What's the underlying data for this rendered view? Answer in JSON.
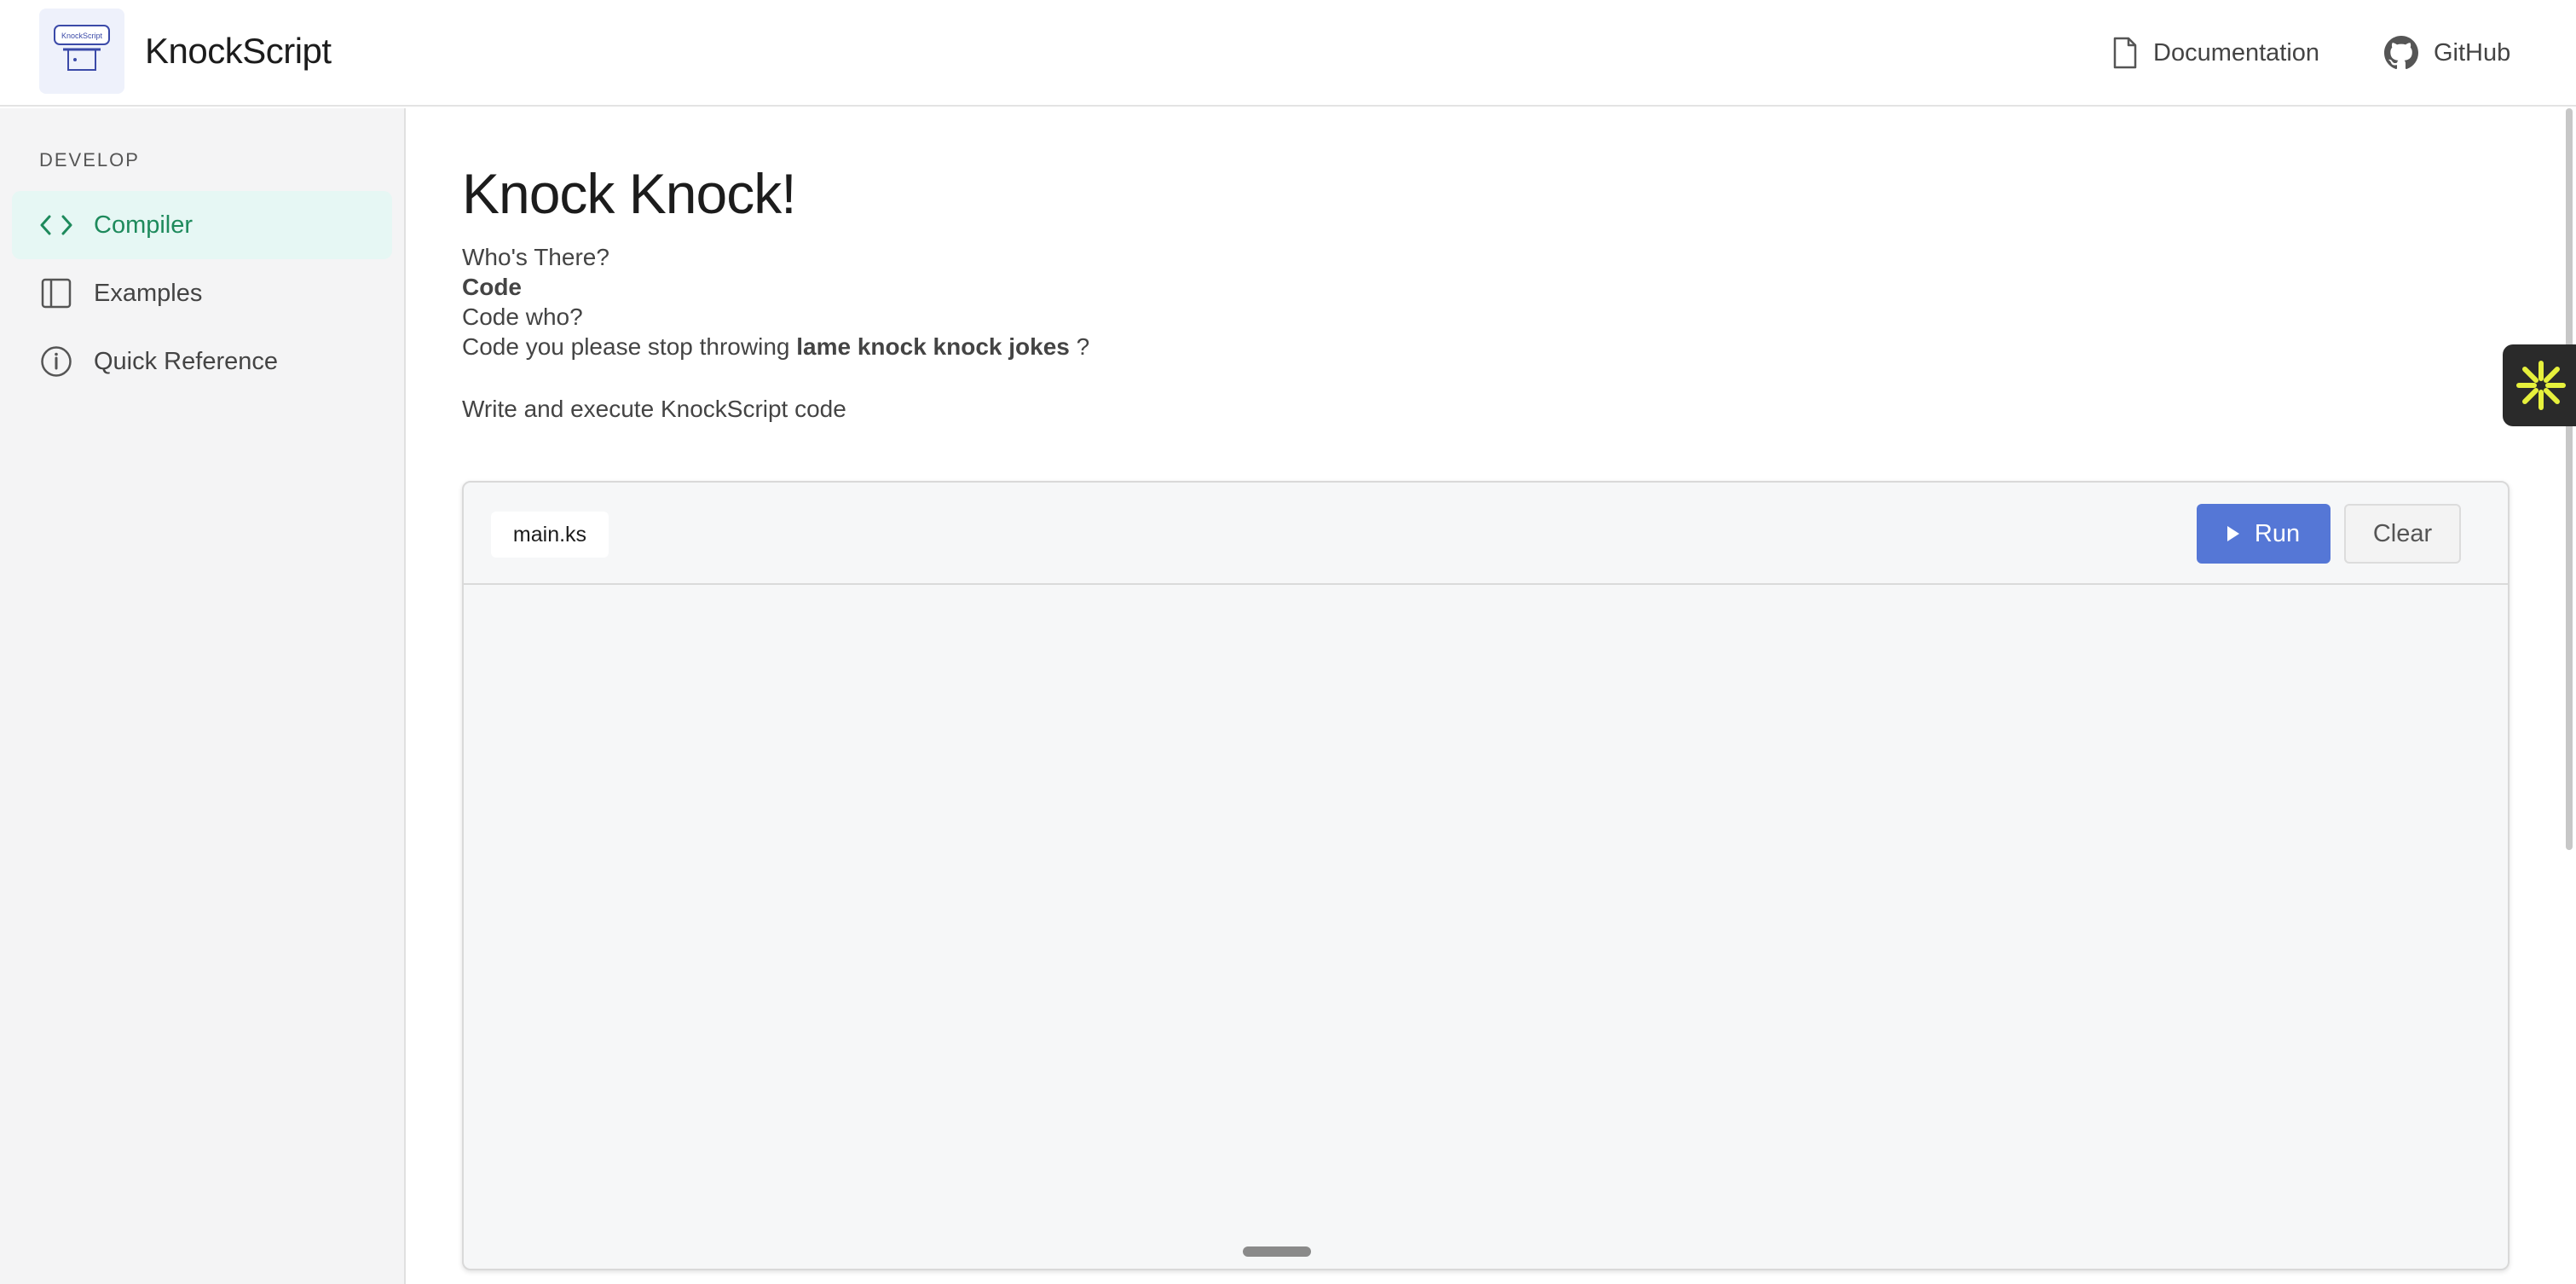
{
  "header": {
    "logo_text": "KnockScript",
    "app_name": "KnockScript",
    "documentation_label": "Documentation",
    "github_label": "GitHub"
  },
  "sidebar": {
    "section_title": "DEVELOP",
    "items": [
      {
        "label": "Compiler",
        "icon": "code-brackets-icon",
        "active": true
      },
      {
        "label": "Examples",
        "icon": "sidebar-panel-icon",
        "active": false
      },
      {
        "label": "Quick Reference",
        "icon": "info-circle-icon",
        "active": false
      }
    ]
  },
  "main": {
    "title": "Knock Knock!",
    "joke": {
      "line1": "Who's There?",
      "line2": "Code",
      "line3": "Code who?",
      "line4_prefix": "Code you please stop throwing",
      "line4_bold": "lame knock knock jokes",
      "line4_suffix": "?"
    },
    "subtitle": "Write and execute KnockScript code",
    "editor": {
      "file_tab": "main.ks",
      "run_label": "Run",
      "clear_label": "Clear",
      "code": ""
    }
  },
  "colors": {
    "accent": "#5577d6",
    "active_nav_bg": "#e6f7f4",
    "active_nav_text": "#1e8a5c",
    "widget_star": "#e6f03c"
  }
}
